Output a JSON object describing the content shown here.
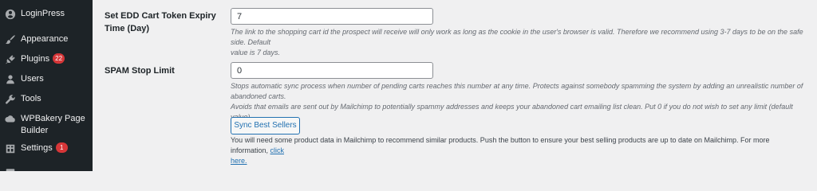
{
  "sidebar": {
    "items": [
      {
        "label": "LoginPress",
        "icon": "loginpress-icon"
      },
      {
        "label": "Appearance",
        "icon": "paintbrush-icon"
      },
      {
        "label": "Plugins",
        "icon": "plugins-icon",
        "badge": "22"
      },
      {
        "label": "Users",
        "icon": "users-icon"
      },
      {
        "label": "Tools",
        "icon": "tools-icon"
      },
      {
        "label": "WPBakery Page Builder",
        "label_line1": "WPBakery Page",
        "label_line2": "Builder",
        "icon": "wpbakery-icon"
      },
      {
        "label": "Settings",
        "icon": "settings-icon",
        "badge": "1"
      }
    ]
  },
  "settings": {
    "edd_expiry": {
      "label_line1": "Set EDD Cart Token Expiry",
      "label_line2": "Time (Day)",
      "value": "7",
      "desc_line1": "The link to the shopping cart id the prospect will receive will only work as long as the cookie in the user's browser is valid. Therefore we recommend using 3-7 days to be on the safe side. Default",
      "desc_line2": "value is 7 days."
    },
    "spam_limit": {
      "label": "SPAM Stop Limit",
      "value": "0",
      "desc_line1": "Stops automatic sync process when number of pending carts reaches this number at any time. Protects against somebody spamming the system by adding an unrealistic number of abandoned carts.",
      "desc_line2": "Avoids that emails are sent out by Mailchimp to potentially spammy addresses and keeps your abandoned cart emailing list clean. Put 0 if you do not wish to set any limit (default value)."
    },
    "best_sellers": {
      "button_label": "Sync Best Sellers",
      "info_text": "You will need some product data in Mailchimp to recommend similar products. Push the button to ensure your best selling products are up to date on Mailchimp. For more information, ",
      "link_line1": "click",
      "link_line2": "here."
    }
  },
  "colors": {
    "sidebar_bg": "#1d2327",
    "content_bg": "#f0f0f1",
    "accent": "#2271b1",
    "badge": "#d63638"
  }
}
